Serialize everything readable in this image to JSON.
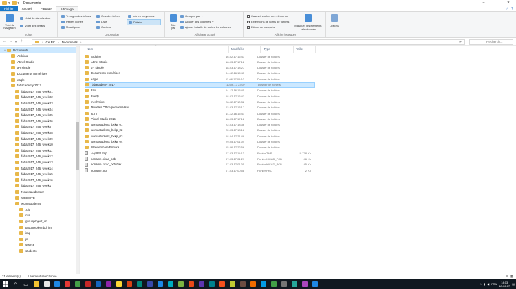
{
  "window": {
    "title": "Documents",
    "controls": [
      "–",
      "☐",
      "✕"
    ]
  },
  "ribbon_tabs": [
    "Fichier",
    "Accueil",
    "Partage",
    "Affichage"
  ],
  "ribbon": {
    "panels": {
      "nav_pane": "Volet de navigation",
      "preview": "Volet de visualisation",
      "details": "Volet des détails",
      "label": "Volets"
    },
    "layout": {
      "items": [
        "Très grandes icônes",
        "Grandes icônes",
        "Icônes moyennes",
        "Petites icônes",
        "Liste",
        "Détails",
        "Mosaïques",
        "Contenu"
      ],
      "label": "Disposition"
    },
    "current_view": {
      "sort": "Trier par",
      "group": "Grouper par",
      "add_columns": "Ajouter des colonnes",
      "fit_columns": "Ajuster la taille de toutes les colonnes",
      "label": "Affichage actuel"
    },
    "show_hide": {
      "checkboxes": [
        {
          "label": "Cases à cocher des éléments",
          "checked": false
        },
        {
          "label": "Extensions de noms de fichiers",
          "checked": true
        },
        {
          "label": "Éléments masqués",
          "checked": true
        }
      ],
      "hide_selected": "Masquer les éléments sélectionnés",
      "label": "Afficher/Masquer"
    },
    "options": "Options"
  },
  "address": {
    "path": [
      "Ce PC",
      "Documents"
    ],
    "search_placeholder": "Recherch..."
  },
  "columns": {
    "name": "Nom",
    "date": "Modifié le",
    "type": "Type",
    "size": "Taille"
  },
  "navpane": [
    {
      "label": "Documents",
      "indent": 0,
      "selected": true,
      "icon": "folder"
    },
    {
      "label": "Arduino",
      "indent": 1,
      "icon": "folder"
    },
    {
      "label": "Atmel Studio",
      "indent": 1,
      "icon": "folder"
    },
    {
      "label": "a-r simple",
      "indent": 1,
      "icon": "folder"
    },
    {
      "label": "Documents numérisés",
      "indent": 1,
      "icon": "folder"
    },
    {
      "label": "eagle",
      "indent": 1,
      "icon": "folder"
    },
    {
      "label": "fabacademy 2017",
      "indent": 1,
      "icon": "folder"
    },
    {
      "label": "faba2017_246_week01",
      "indent": 2,
      "icon": "folder"
    },
    {
      "label": "faba2017_246_week02",
      "indent": 2,
      "icon": "folder"
    },
    {
      "label": "faba2017_246_week03",
      "indent": 2,
      "icon": "folder"
    },
    {
      "label": "faba2017_246_week04",
      "indent": 2,
      "icon": "folder"
    },
    {
      "label": "faba2017_246_week05",
      "indent": 2,
      "icon": "folder"
    },
    {
      "label": "faba2017_246_week06",
      "indent": 2,
      "icon": "folder"
    },
    {
      "label": "faba2017_246_week07",
      "indent": 2,
      "icon": "folder"
    },
    {
      "label": "faba2017_246_week08",
      "indent": 2,
      "icon": "folder"
    },
    {
      "label": "faba2017_246_week09",
      "indent": 2,
      "icon": "folder"
    },
    {
      "label": "faba2017_246_week10",
      "indent": 2,
      "icon": "folder"
    },
    {
      "label": "faba2017_246_week11",
      "indent": 2,
      "icon": "folder"
    },
    {
      "label": "faba2017_246_week12",
      "indent": 2,
      "icon": "folder"
    },
    {
      "label": "faba2017_246_week13",
      "indent": 2,
      "icon": "folder"
    },
    {
      "label": "faba2017_246_week14",
      "indent": 2,
      "icon": "folder"
    },
    {
      "label": "faba2017_246_week15",
      "indent": 2,
      "icon": "folder"
    },
    {
      "label": "faba2017_246_week16",
      "indent": 2,
      "icon": "folder"
    },
    {
      "label": "faba2017_246_week17",
      "indent": 2,
      "icon": "folder"
    },
    {
      "label": "Nouveau dossier",
      "indent": 2,
      "icon": "folder"
    },
    {
      "label": "WEBSITE",
      "indent": 2,
      "icon": "folder"
    },
    {
      "label": "womastudents",
      "indent": 2,
      "icon": "folder"
    },
    {
      "label": ".git",
      "indent": 3,
      "icon": "folder"
    },
    {
      "label": "css",
      "indent": 3,
      "icon": "folder"
    },
    {
      "label": "groupproject_im",
      "indent": 3,
      "icon": "folder"
    },
    {
      "label": "groupproject-bd_im",
      "indent": 3,
      "icon": "folder"
    },
    {
      "label": "img",
      "indent": 3,
      "icon": "folder"
    },
    {
      "label": "js",
      "indent": 3,
      "icon": "folder"
    },
    {
      "label": "source",
      "indent": 3,
      "icon": "folder"
    },
    {
      "label": "students",
      "indent": 3,
      "icon": "folder"
    }
  ],
  "files": [
    {
      "name": "Arduino",
      "date": "16-02-17 16:43",
      "type": "Dossier de fichiers",
      "size": "",
      "icon": "folder"
    },
    {
      "name": "Atmel Studio",
      "date": "18-03-17 17:12",
      "type": "Dossier de fichiers",
      "size": "",
      "icon": "folder"
    },
    {
      "name": "a-r simple",
      "date": "18-03-17 18:27",
      "type": "Dossier de fichiers",
      "size": "",
      "icon": "folder"
    },
    {
      "name": "Documents numérisés",
      "date": "04-12-16 15:45",
      "type": "Dossier de fichiers",
      "size": "",
      "icon": "folder"
    },
    {
      "name": "eagle",
      "date": "11-06-17 06:10",
      "type": "Dossier de fichiers",
      "size": "",
      "icon": "folder"
    },
    {
      "name": "fabacademy 2017",
      "date": "10-06-17 23:07",
      "type": "Dossier de fichiers",
      "size": "",
      "icon": "folder",
      "selected": true
    },
    {
      "name": "Fax",
      "date": "14-12-16 15:45",
      "type": "Dossier de fichiers",
      "size": "",
      "icon": "folder"
    },
    {
      "name": "Firefly",
      "date": "18-02-17 16:43",
      "type": "Dossier de fichiers",
      "size": "",
      "icon": "folder"
    },
    {
      "name": "meshmixer",
      "date": "28-02-17 10:32",
      "type": "Dossier de fichiers",
      "size": "",
      "icon": "folder"
    },
    {
      "name": "Modèles Office personnalisés",
      "date": "02-03-17 13:17",
      "type": "Dossier de fichiers",
      "size": "",
      "icon": "folder"
    },
    {
      "name": "R.TT",
      "date": "14-12-16 15:41",
      "type": "Dossier de fichiers",
      "size": "",
      "icon": "folder"
    },
    {
      "name": "Visual Studio 2015",
      "date": "18-03-17 17:12",
      "type": "Dossier de fichiers",
      "size": "",
      "icon": "folder"
    },
    {
      "name": "womastudents_bckp_01",
      "date": "22-03-17 18:36",
      "type": "Dossier de fichiers",
      "size": "",
      "icon": "folder"
    },
    {
      "name": "womastudents_bckp_02",
      "date": "22-03-17 18:18",
      "type": "Dossier de fichiers",
      "size": "",
      "icon": "folder"
    },
    {
      "name": "womastudents_bckp_03",
      "date": "18-04-17 21:48",
      "type": "Dossier de fichiers",
      "size": "",
      "icon": "folder"
    },
    {
      "name": "womastudents_bckp_04",
      "date": "29-05-17 01:04",
      "type": "Dossier de fichiers",
      "size": "",
      "icon": "folder"
    },
    {
      "name": "Wondershare Filmora",
      "date": "15-06-17 22:56",
      "type": "Dossier de fichiers",
      "size": "",
      "icon": "folder"
    },
    {
      "name": "~vjd932.tmp",
      "date": "07-03-17 11:13",
      "type": "Fichier TMP",
      "size": "10 778 Ko",
      "icon": "file"
    },
    {
      "name": "noname.kicad_pcb",
      "date": "07-03-17 01:21",
      "type": "Fichier KICAD_PCB",
      "size": "46 Ko",
      "icon": "file"
    },
    {
      "name": "noname.kicad_pcb-bak",
      "date": "07-03-17 01:05",
      "type": "Fichier KICAD_PCB-...",
      "size": "45 Ko",
      "icon": "file"
    },
    {
      "name": "noname.pro",
      "date": "07-03-17 00:58",
      "type": "Fichier PRO",
      "size": "2 Ko",
      "icon": "file"
    }
  ],
  "status": {
    "count": "21 élément(s)",
    "selected": "1 élément sélectionné"
  },
  "taskbar": {
    "search": "⌕",
    "task_view": "▭",
    "apps": [
      "#f1c232",
      "#e8e8e8",
      "#1e88e5",
      "#e53935",
      "#43a047",
      "#c62828",
      "#1565c0",
      "#8e24aa",
      "#fdd835",
      "#d84315",
      "#00897b",
      "#3949ab",
      "#1e88e5",
      "#00acc1",
      "#7cb342",
      "#e64a19",
      "#5e35b1",
      "#00838f",
      "#f4511e",
      "#c0ca33",
      "#6d4c41",
      "#ef6c00",
      "#039be5",
      "#43a047",
      "#757575",
      "#26a69a",
      "#ab47bc",
      "#1e88e5"
    ],
    "lang": "FRA",
    "time": "14:13",
    "date": "18-06-17"
  }
}
